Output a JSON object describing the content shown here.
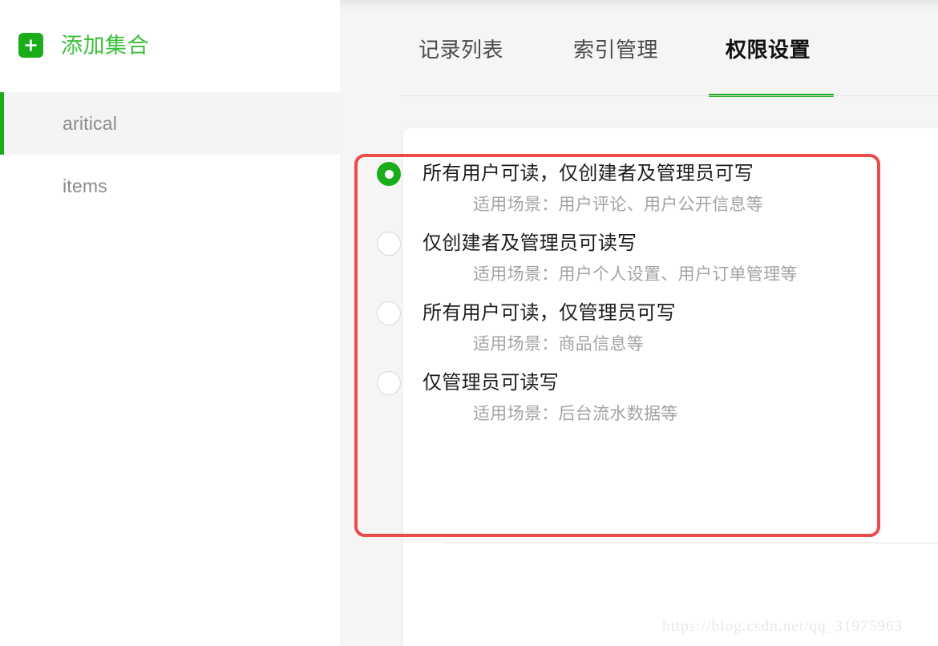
{
  "sidebar": {
    "add_collection": {
      "label": "添加集合",
      "icon": "plus-icon",
      "icon_color": "#1aad19",
      "text_color": "#3bbf3a"
    },
    "items": [
      {
        "label": "aritical",
        "selected": true
      },
      {
        "label": "items",
        "selected": false
      }
    ],
    "selected_marker_color": "#1aad19",
    "selected_bg": "#f4f4f4"
  },
  "main": {
    "tabs": [
      {
        "label": "记录列表",
        "active": false
      },
      {
        "label": "索引管理",
        "active": false
      },
      {
        "label": "权限设置",
        "active": true
      }
    ],
    "active_tab_indicator_color": "#1aad19",
    "highlight_box_color": "#ed4a4a",
    "permissions": {
      "selected_index": 0,
      "options": [
        {
          "label": "所有用户可读，仅创建者及管理员可写",
          "description": "适用场景：用户评论、用户公开信息等",
          "selected": true
        },
        {
          "label": "仅创建者及管理员可读写",
          "description": "适用场景：用户个人设置、用户订单管理等",
          "selected": false
        },
        {
          "label": "所有用户可读，仅管理员可写",
          "description": "适用场景：商品信息等",
          "selected": false
        },
        {
          "label": "仅管理员可读写",
          "description": "适用场景：后台流水数据等",
          "selected": false
        }
      ]
    }
  },
  "watermark": {
    "text": "https://blog.csdn.net/qq_31975963"
  }
}
